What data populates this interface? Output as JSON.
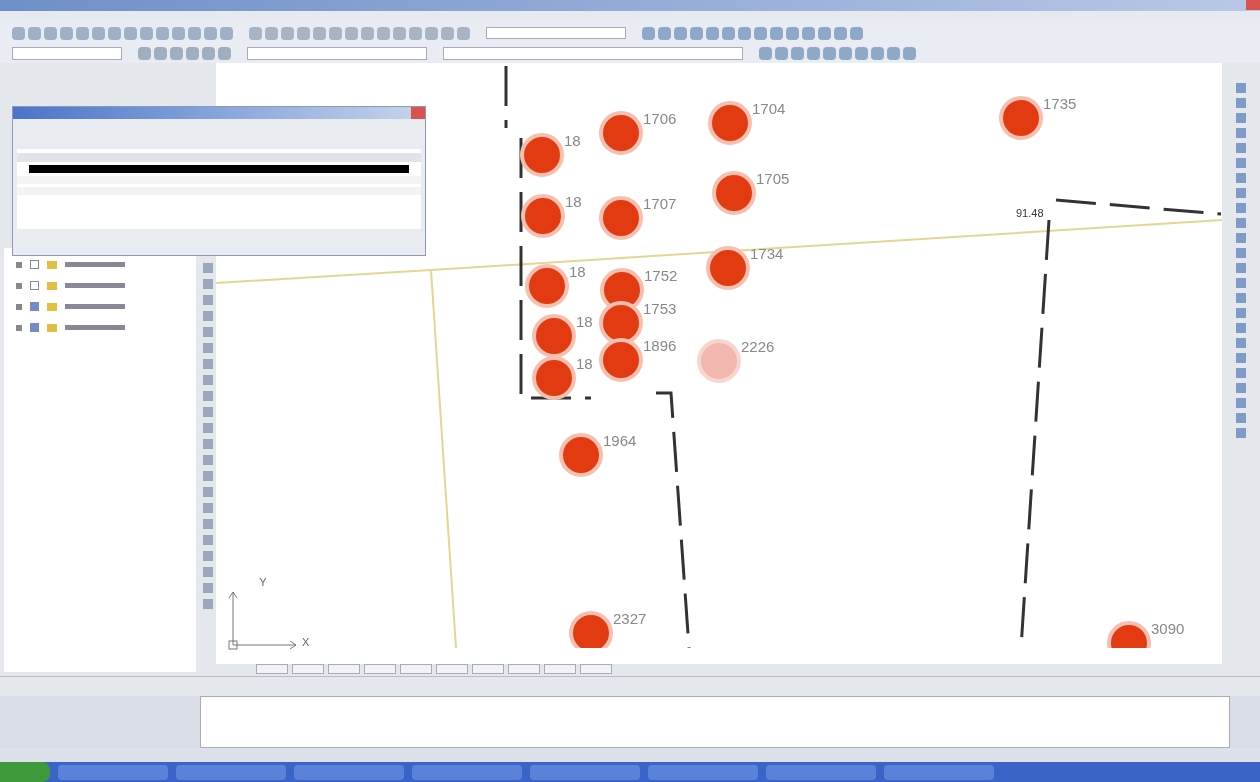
{
  "map": {
    "points": [
      {
        "label": "18",
        "selected": false
      },
      {
        "label": "1706",
        "selected": false
      },
      {
        "label": "1704",
        "selected": false
      },
      {
        "label": "1735",
        "selected": false
      },
      {
        "label": "18",
        "selected": false
      },
      {
        "label": "1707",
        "selected": false
      },
      {
        "label": "1705",
        "selected": false
      },
      {
        "label": "1734",
        "selected": false
      },
      {
        "label": "18",
        "selected": false
      },
      {
        "label": "1752",
        "selected": false
      },
      {
        "label": "1753",
        "selected": false
      },
      {
        "label": "18",
        "selected": false
      },
      {
        "label": "1896",
        "selected": false
      },
      {
        "label": "2226",
        "selected": true
      },
      {
        "label": "18",
        "selected": false
      },
      {
        "label": "1964",
        "selected": false
      },
      {
        "label": "2327",
        "selected": false
      },
      {
        "label": "3090",
        "selected": false
      }
    ],
    "dimension": "91.48",
    "ucs": {
      "y": "Y",
      "x": "X"
    }
  },
  "tree": {
    "items": [
      {
        "checked": false
      },
      {
        "checked": false
      },
      {
        "checked": true
      },
      {
        "checked": true
      }
    ]
  }
}
